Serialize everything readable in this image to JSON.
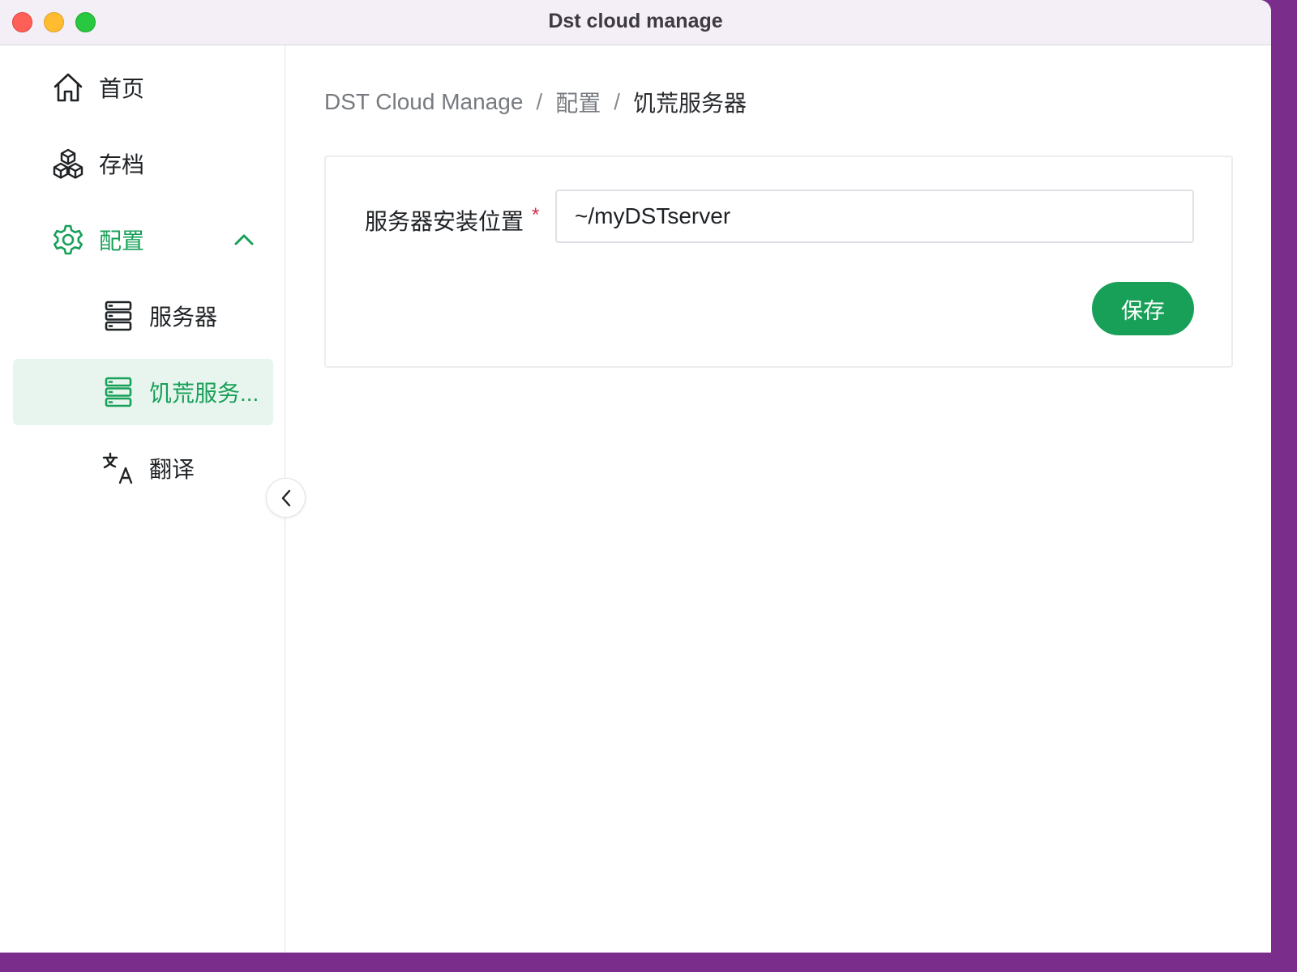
{
  "window": {
    "title": "Dst cloud manage"
  },
  "sidebar": {
    "items": [
      {
        "label": "首页",
        "icon": "home-icon"
      },
      {
        "label": "存档",
        "icon": "cubes-icon"
      },
      {
        "label": "配置",
        "icon": "gear-icon",
        "expanded": true
      },
      {
        "label": "服务器",
        "icon": "server-icon"
      },
      {
        "label": "饥荒服务...",
        "icon": "server-icon",
        "selected": true
      },
      {
        "label": "翻译",
        "icon": "translate-icon"
      }
    ],
    "collapse_icon": "chevron-left-icon"
  },
  "breadcrumb": [
    "DST Cloud Manage",
    "/",
    "配置",
    "/",
    "饥荒服务器"
  ],
  "form": {
    "install_path_label": "服务器安装位置",
    "required_mark": "*",
    "install_path_value": "~/myDSTserver",
    "save_label": "保存"
  },
  "colors": {
    "accent": "#18a058",
    "selected_bg": "#e7f5ee",
    "required": "#d03050",
    "titlebar_bg": "#f4eef6"
  }
}
